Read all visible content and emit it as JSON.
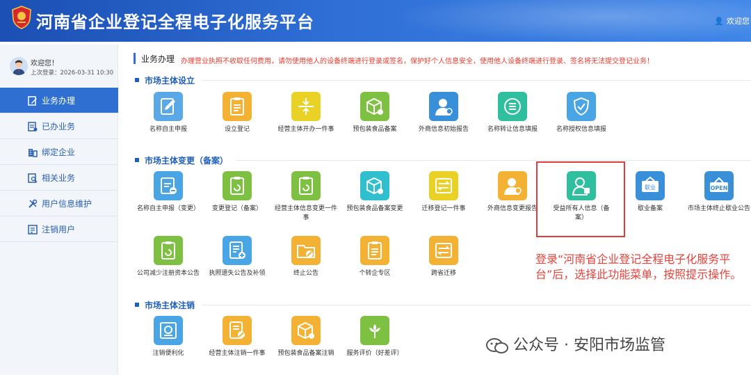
{
  "header": {
    "title": "河南省企业登记全程电子化服务平台",
    "welcome": "欢迎您"
  },
  "sidebar": {
    "hello": "欢迎您！",
    "last_login": "上次登录：2026-03-31 10:30",
    "items": [
      {
        "label": "业务办理",
        "icon": "edit-icon",
        "active": true
      },
      {
        "label": "已办业务",
        "icon": "done-doc-icon"
      },
      {
        "label": "绑定企业",
        "icon": "building-icon"
      },
      {
        "label": "相关业务",
        "icon": "related-doc-icon"
      },
      {
        "label": "用户信息维护",
        "icon": "tools-icon"
      },
      {
        "label": "注销用户",
        "icon": "form-icon"
      }
    ]
  },
  "main": {
    "heading": "业务办理",
    "notice": "办理营业执照不收取任何费用，请勿使用他人的设备终端进行登录或签名，保护好个人信息安全，使用他人设备终端进行登录、签名将无法提交登记业务！",
    "sections": [
      {
        "title": "市场主体设立",
        "items": [
          {
            "label": "名称自主申报",
            "color": "#5aa9e6"
          },
          {
            "label": "设立登记",
            "color": "#f3b233"
          },
          {
            "label": "经营主体开办一件事",
            "color": "#e9d126"
          },
          {
            "label": "预包装食品备案",
            "color": "#7ec142"
          },
          {
            "label": "外商信息初始报告",
            "color": "#3a8fd9"
          },
          {
            "label": "名称转让信息填报",
            "color": "#2fbf9f"
          },
          {
            "label": "名称授权信息填报",
            "color": "#4aa5e4"
          }
        ]
      },
      {
        "title": "市场主体变更（备案）",
        "items": [
          {
            "label": "名称自主申报（变更）",
            "color": "#4aa5e4"
          },
          {
            "label": "变更登记（备案）",
            "color": "#7ec142"
          },
          {
            "label": "经营主体信息变更一件事",
            "color": "#7ec142"
          },
          {
            "label": "预包装食品备案变更",
            "color": "#2fbfcf"
          },
          {
            "label": "迁移登记一件事",
            "color": "#e9d126"
          },
          {
            "label": "外商信息变更报告",
            "color": "#f3b233"
          },
          {
            "label": "受益所有人信息（备案）",
            "color": "#2fbf9f"
          },
          {
            "label": "歇业备案",
            "color": "#3a8fd9"
          },
          {
            "label": "市场主体终止歇业公告",
            "color": "#3a8fd9"
          },
          {
            "label": "公司减少注册资本公告",
            "color": "#7ec142"
          },
          {
            "label": "执照遗失公告及补领",
            "color": "#4aa5e4"
          },
          {
            "label": "终止公告",
            "color": "#f3b233"
          },
          {
            "label": "个转企专区",
            "color": "#f3b233"
          },
          {
            "label": "跨省迁移",
            "color": "#f3b233"
          }
        ]
      },
      {
        "title": "市场主体注销",
        "items": [
          {
            "label": "注销便利化",
            "color": "#4aa5e4"
          },
          {
            "label": "经营主体注销一件事",
            "color": "#f3b233"
          },
          {
            "label": "预包装食品备案注销",
            "color": "#f3b233"
          },
          {
            "label": "服务评价（好差评）",
            "color": "#7ec142"
          }
        ]
      }
    ]
  },
  "callout": "登录“河南省企业登记全程电子化服务平台”后，选择此功能菜单，按照提示操作。",
  "watermark": "公众号 · 安阳市场监管",
  "ui_icon_words": {
    "suspend": "歇业",
    "open": "OPEN"
  },
  "colors": {
    "header": "#2f6fd6",
    "sidebar_active": "#2e6fd1",
    "notice": "#e63b2e",
    "section": "#1f5fb8",
    "highlight": "#e23b3b"
  }
}
